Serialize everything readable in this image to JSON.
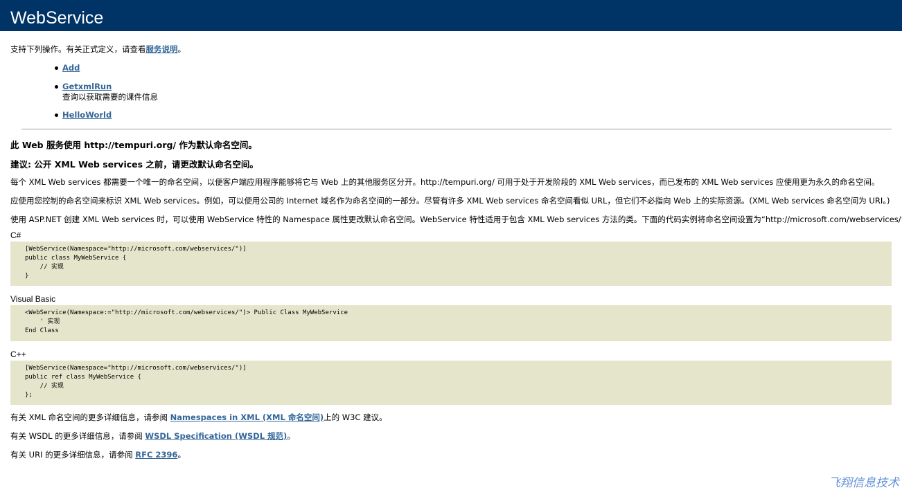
{
  "header": {
    "title": "WebService"
  },
  "intro": {
    "text": "支持下列操作。有关正式定义，请查看",
    "link": "服务说明",
    "suffix": "。"
  },
  "operations": [
    {
      "name": "Add",
      "description": ""
    },
    {
      "name": "GetxmlRun",
      "description": "查询以获取需要的课件信息"
    },
    {
      "name": "HelloWorld",
      "description": ""
    }
  ],
  "namespace_notice": {
    "heading1": "此 Web 服务使用 http://tempuri.org/ 作为默认命名空间。",
    "heading2": "建议: 公开 XML Web services 之前，请更改默认命名空间。",
    "para1": "每个 XML Web services 都需要一个唯一的命名空间，以便客户端应用程序能够将它与 Web 上的其他服务区分开。http://tempuri.org/ 可用于处于开发阶段的 XML Web services，而已发布的 XML Web services 应使用更为永久的命名空间。",
    "para2": "应使用您控制的命名空间来标识 XML Web services。例如，可以使用公司的 Internet 域名作为命名空间的一部分。尽管有许多 XML Web services 命名空间看似 URL，但它们不必指向 Web 上的实际资源。(XML Web services 命名空间为 URI。)",
    "para3": "使用 ASP.NET 创建 XML Web services 时，可以使用 WebService 特性的 Namespace 属性更改默认命名空间。WebService 特性适用于包含 XML Web services 方法的类。下面的代码实例将命名空间设置为“http://microsoft.com/webservices/”:"
  },
  "code_samples": [
    {
      "language": "C#",
      "code": "[WebService(Namespace=\"http://microsoft.com/webservices/\")]\npublic class MyWebService {\n    // 实现\n}"
    },
    {
      "language": "Visual Basic",
      "code": "<WebService(Namespace:=\"http://microsoft.com/webservices/\")> Public Class MyWebService\n    ' 实现\nEnd Class"
    },
    {
      "language": "C++",
      "code": "[WebService(Namespace=\"http://microsoft.com/webservices/\")]\npublic ref class MyWebService {\n    // 实现\n};"
    }
  ],
  "footer_links": [
    {
      "prefix": "有关 XML 命名空间的更多详细信息，请参阅 ",
      "link": "Namespaces in XML (XML 命名空间)",
      "suffix": "上的 W3C 建议。"
    },
    {
      "prefix": "有关 WSDL 的更多详细信息，请参阅 ",
      "link": "WSDL Specification (WSDL 规范)",
      "suffix": "。"
    },
    {
      "prefix": "有关 URI 的更多详细信息，请参阅 ",
      "link": "RFC 2396",
      "suffix": "。"
    }
  ],
  "watermark": {
    "text": "飞翔信息技术"
  }
}
